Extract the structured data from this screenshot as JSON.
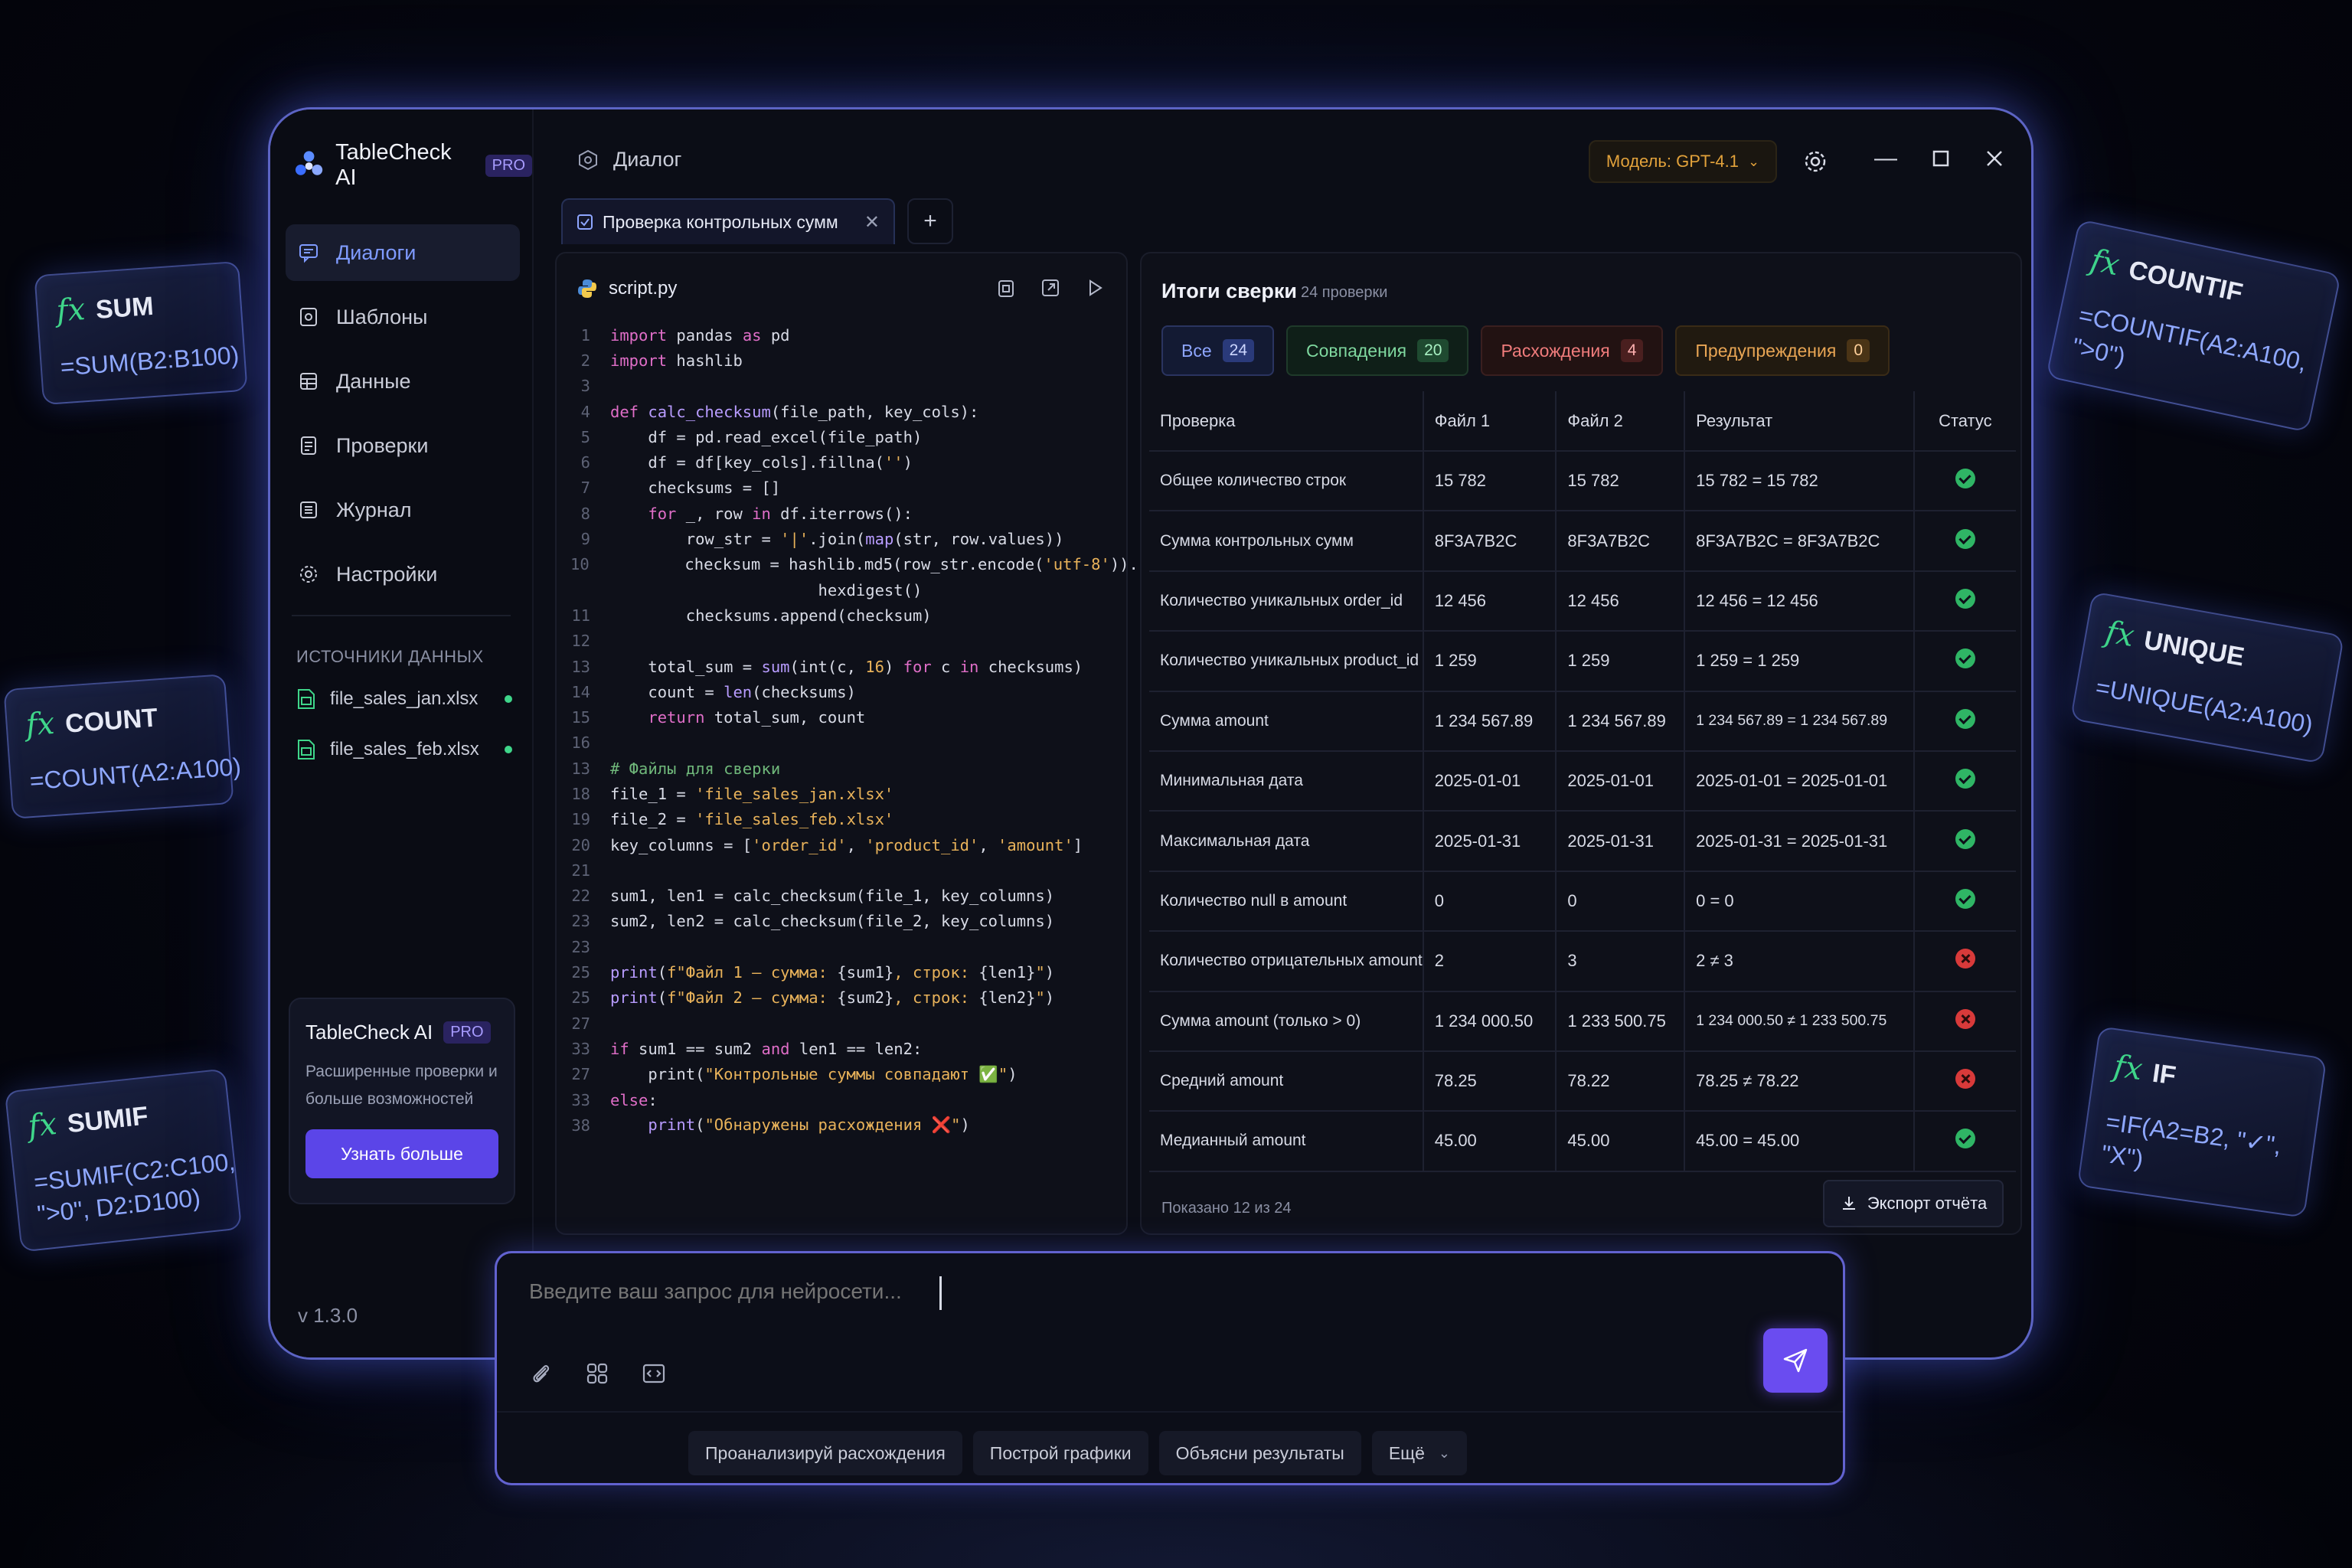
{
  "app": {
    "name": "TableCheck AI",
    "pro": "PRO",
    "version": "v 1.3.0"
  },
  "sidebar": {
    "items": [
      {
        "label": "Диалоги",
        "icon": "chat-icon",
        "active": true
      },
      {
        "label": "Шаблоны",
        "icon": "template-icon"
      },
      {
        "label": "Данные",
        "icon": "data-icon"
      },
      {
        "label": "Проверки",
        "icon": "checklist-icon"
      },
      {
        "label": "Журнал",
        "icon": "journal-icon"
      },
      {
        "label": "Настройки",
        "icon": "gear-icon"
      }
    ],
    "sources_title": "ИСТОЧНИКИ ДАННЫХ",
    "sources": [
      {
        "name": "file_sales_jan.xlsx",
        "status": "connected"
      },
      {
        "name": "file_sales_feb.xlsx",
        "status": "connected"
      }
    ],
    "promo": {
      "title": "TableCheck AI",
      "badge": "PRO",
      "description": "Расширенные проверки и больше возможностей",
      "button": "Узнать больше"
    }
  },
  "header": {
    "title": "Диалог",
    "model": "Модель: GPT-4.1"
  },
  "tabs": [
    {
      "label": "Проверка контрольных сумм",
      "active": true
    }
  ],
  "editor": {
    "filename": "script.py"
  },
  "results": {
    "title": "Итоги сверки",
    "subtitle": "24 проверки",
    "filters": [
      {
        "label": "Все",
        "count": "24"
      },
      {
        "label": "Совпадения",
        "count": "20"
      },
      {
        "label": "Расхождения",
        "count": "4"
      },
      {
        "label": "Предупреждения",
        "count": "0"
      }
    ],
    "columns": [
      "Проверка",
      "Файл 1",
      "Файл 2",
      "Результат",
      "Статус"
    ],
    "rows": [
      {
        "check": "Общее количество строк",
        "f1": "15 782",
        "f2": "15 782",
        "result": "15 782 = 15 782",
        "kind": "ok",
        "status": "ok"
      },
      {
        "check": "Сумма контрольных сумм",
        "f1": "8F3A7B2C",
        "f2": "8F3A7B2C",
        "result": "8F3A7B2C = 8F3A7B2C",
        "kind": "neutral",
        "status": "ok"
      },
      {
        "check": "Количество уникальных order_id",
        "f1": "12 456",
        "f2": "12 456",
        "result": "12 456 = 12 456",
        "kind": "ok",
        "status": "ok"
      },
      {
        "check": "Количество уникальных product_id",
        "f1": "1 259",
        "f2": "1 259",
        "result": "1 259 = 1 259",
        "kind": "ok",
        "status": "ok"
      },
      {
        "check": "Сумма amount",
        "f1": "1 234 567.89",
        "f2": "1 234 567.89",
        "result": "1 234 567.89 = 1 234 567.89",
        "kind": "ok-small",
        "status": "ok"
      },
      {
        "check": "Минимальная дата",
        "f1": "2025-01-01",
        "f2": "2025-01-01",
        "result": "2025-01-01 = 2025-01-01",
        "kind": "ok",
        "status": "ok"
      },
      {
        "check": "Максимальная дата",
        "f1": "2025-01-31",
        "f2": "2025-01-31",
        "result": "2025-01-31 = 2025-01-31",
        "kind": "ok",
        "status": "ok"
      },
      {
        "check": "Количество null в amount",
        "f1": "0",
        "f2": "0",
        "result": "0 = 0",
        "kind": "ok",
        "status": "ok"
      },
      {
        "check": "Количество отрицательных amount",
        "f1": "2",
        "f2": "3",
        "result": "2 ≠ 3",
        "kind": "bad",
        "status": "bad"
      },
      {
        "check": "Сумма amount (только > 0)",
        "f1": "1 234 000.50",
        "f2": "1 233 500.75",
        "result": "1 234 000.50 ≠ 1 233 500.75",
        "kind": "bad-small",
        "status": "bad"
      },
      {
        "check": "Средний amount",
        "f1": "78.25",
        "f2": "78.22",
        "result": "78.25 ≠ 78.22",
        "kind": "bad",
        "status": "bad"
      },
      {
        "check": "Медианный amount",
        "f1": "45.00",
        "f2": "45.00",
        "result": "45.00 = 45.00",
        "kind": "ok",
        "status": "ok"
      }
    ],
    "shown": "Показано 12 из 24",
    "export": "Экспорт отчёта"
  },
  "prompt": {
    "placeholder": "Введите ваш запрос для нейросети...",
    "suggestions": [
      "Проанализируй расхождения",
      "Построй графики",
      "Объясни результаты"
    ],
    "more": "Ещё"
  },
  "formula_cards": [
    {
      "name": "SUM",
      "formula": "=SUM(B2:B100)"
    },
    {
      "name": "COUNT",
      "formula": "=COUNT(A2:A100)"
    },
    {
      "name": "SUMIF",
      "formula": "=SUMIF(C2:C100, \">0\", D2:D100)"
    },
    {
      "name": "COUNTIF",
      "formula": "=COUNTIF(A2:A100, \">0\")"
    },
    {
      "name": "UNIQUE",
      "formula": "=UNIQUE(A2:A100)"
    },
    {
      "name": "IF",
      "formula": "=IF(A2=B2, \"✓\", \"X\")"
    }
  ],
  "colors": {
    "accent": "#7f9bff",
    "button": "#5b45e8",
    "ok": "#2fb565",
    "bad": "#d83a3a",
    "warn": "#e8a554",
    "model": "#e2a23b"
  }
}
